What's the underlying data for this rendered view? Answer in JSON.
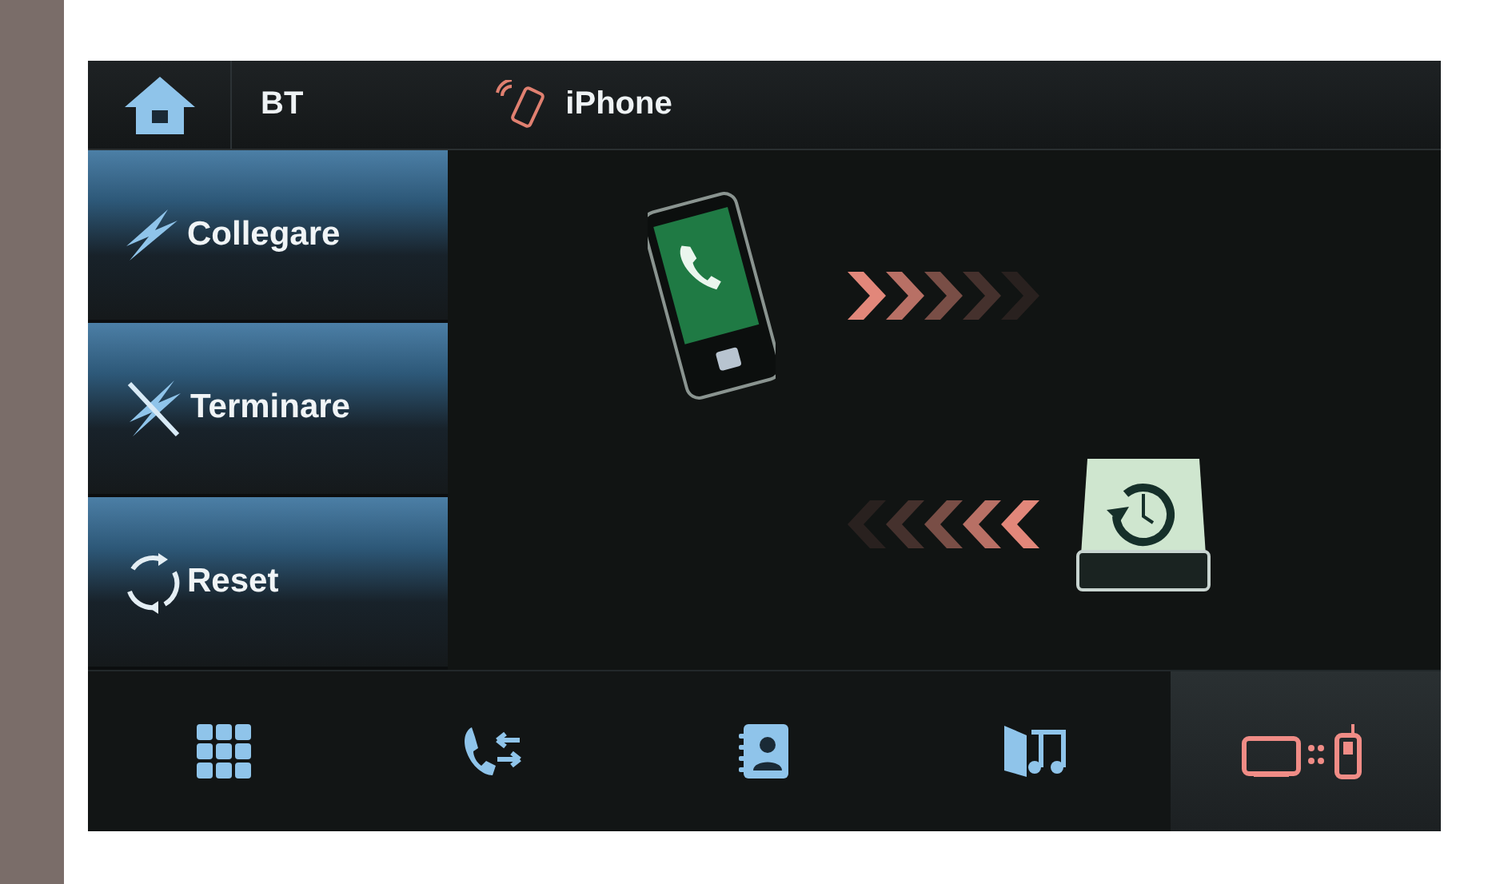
{
  "header": {
    "section": "BT",
    "device": "iPhone"
  },
  "side_buttons": [
    {
      "label": "Collegare",
      "kind": "connect"
    },
    {
      "label": "Terminare",
      "kind": "disconnect"
    },
    {
      "label": "Reset",
      "kind": "reset"
    }
  ],
  "bottom_tabs": [
    {
      "kind": "keypad",
      "selected": false
    },
    {
      "kind": "calls",
      "selected": false
    },
    {
      "kind": "contacts",
      "selected": false
    },
    {
      "kind": "music",
      "selected": false
    },
    {
      "kind": "pairing",
      "selected": true
    }
  ]
}
